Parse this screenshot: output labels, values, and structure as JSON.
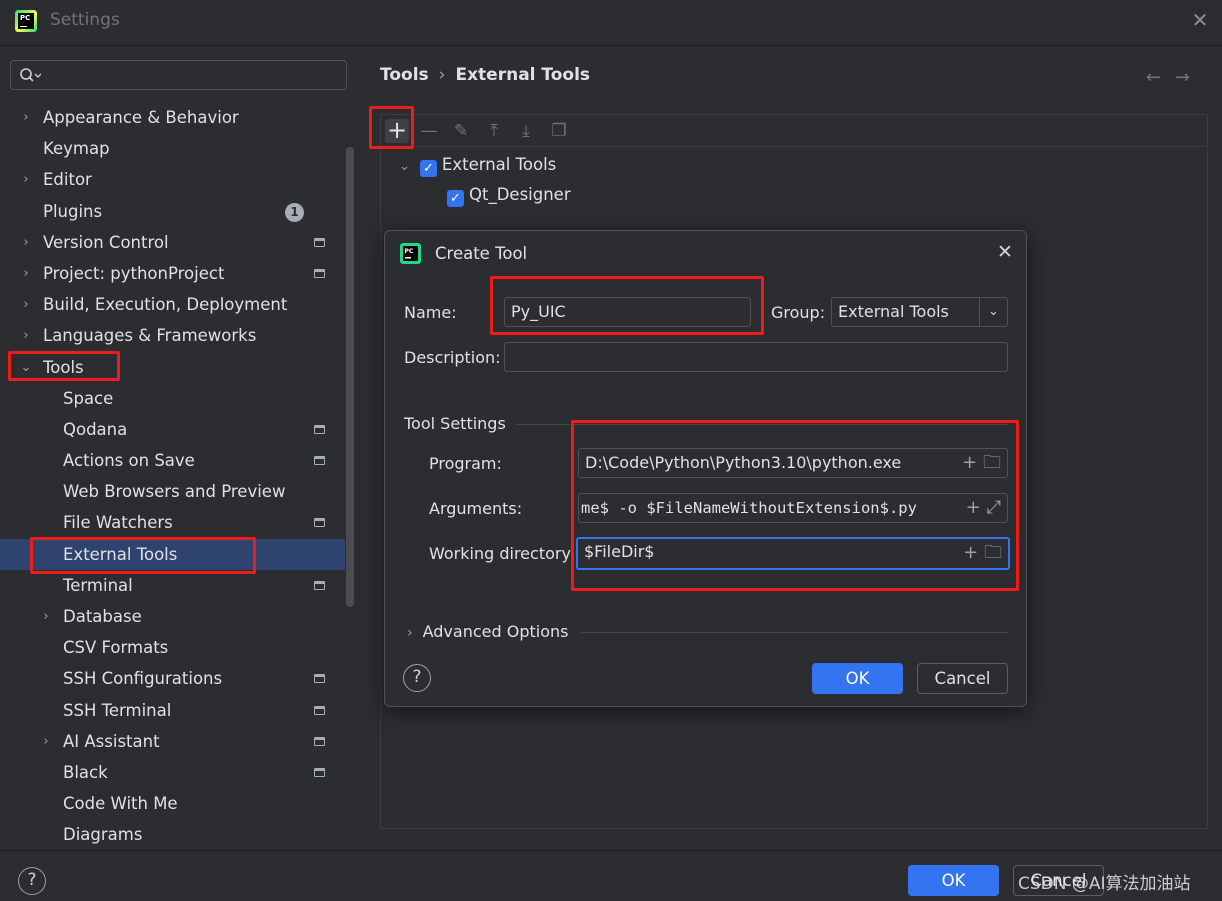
{
  "window": {
    "title": "Settings"
  },
  "search": {
    "placeholder": ""
  },
  "tree": [
    {
      "label": "Appearance & Behavior",
      "level": 0,
      "expandable": true,
      "expanded": false
    },
    {
      "label": "Keymap",
      "level": 0,
      "expandable": false
    },
    {
      "label": "Editor",
      "level": 0,
      "expandable": true,
      "expanded": false
    },
    {
      "label": "Plugins",
      "level": 0,
      "expandable": false,
      "badge": "1"
    },
    {
      "label": "Version Control",
      "level": 0,
      "expandable": true,
      "expanded": false,
      "project": true
    },
    {
      "label": "Project: pythonProject",
      "level": 0,
      "expandable": true,
      "expanded": false,
      "project": true
    },
    {
      "label": "Build, Execution, Deployment",
      "level": 0,
      "expandable": true,
      "expanded": false
    },
    {
      "label": "Languages & Frameworks",
      "level": 0,
      "expandable": true,
      "expanded": false
    },
    {
      "label": "Tools",
      "level": 0,
      "expandable": true,
      "expanded": true
    },
    {
      "label": "Space",
      "level": 1,
      "expandable": false
    },
    {
      "label": "Qodana",
      "level": 1,
      "expandable": false,
      "project": true
    },
    {
      "label": "Actions on Save",
      "level": 1,
      "expandable": false,
      "project": true
    },
    {
      "label": "Web Browsers and Preview",
      "level": 1,
      "expandable": false
    },
    {
      "label": "File Watchers",
      "level": 1,
      "expandable": false,
      "project": true
    },
    {
      "label": "External Tools",
      "level": 1,
      "expandable": false,
      "selected": true
    },
    {
      "label": "Terminal",
      "level": 1,
      "expandable": false,
      "project": true
    },
    {
      "label": "Database",
      "level": 1,
      "expandable": true,
      "expanded": false
    },
    {
      "label": "CSV Formats",
      "level": 1,
      "expandable": false
    },
    {
      "label": "SSH Configurations",
      "level": 1,
      "expandable": false,
      "project": true
    },
    {
      "label": "SSH Terminal",
      "level": 1,
      "expandable": false,
      "project": true
    },
    {
      "label": "AI Assistant",
      "level": 1,
      "expandable": true,
      "expanded": false,
      "project": true
    },
    {
      "label": "Black",
      "level": 1,
      "expandable": false,
      "project": true
    },
    {
      "label": "Code With Me",
      "level": 1,
      "expandable": false
    },
    {
      "label": "Diagrams",
      "level": 1,
      "expandable": false
    }
  ],
  "breadcrumb": {
    "parent": "Tools",
    "separator": "›",
    "current": "External Tools"
  },
  "tools_tree": {
    "group": "External Tools",
    "item": "Qt_Designer"
  },
  "dialog": {
    "title": "Create Tool",
    "name_label": "Name:",
    "name_value": "Py_UIC",
    "group_label": "Group:",
    "group_value": "External Tools",
    "description_label": "Description:",
    "description_value": "",
    "section_title": "Tool Settings",
    "program_label": "Program:",
    "program_value": "D:\\Code\\Python\\Python3.10\\python.exe",
    "arguments_label": "Arguments:",
    "arguments_value": "me$ -o $FileNameWithoutExtension$.py",
    "workdir_label": "Working directory:",
    "workdir_value": "$FileDir$",
    "advanced_label": "Advanced Options",
    "ok_label": "OK",
    "cancel_label": "Cancel",
    "help_label": "?"
  },
  "footer": {
    "ok_label": "OK",
    "cancel_label": "Cancel",
    "help_label": "?"
  },
  "watermark": "CSDN @AI算法加油站",
  "colors": {
    "accent": "#3574f0",
    "selection": "#2e436e",
    "highlight_box": "#ef1c1c",
    "background": "#2b2d30"
  }
}
